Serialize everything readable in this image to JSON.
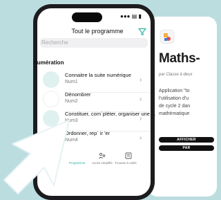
{
  "phone": {
    "status_icons": "●●● ▤ ▮",
    "nav_title": "Tout le programme",
    "search_placeholder": "Recherche",
    "section_label": "Numération",
    "items": [
      {
        "title": "Connaitre la suite numérique",
        "subtitle": "Num1"
      },
      {
        "title": "Dénombrer",
        "subtitle": "Num2"
      },
      {
        "title": "Constituer, com´pléter, organiser une ...",
        "subtitle": "Num3"
      },
      {
        "title": "Ordonner, rep´ ir     'er",
        "subtitle": "Num4"
      }
    ],
    "tabs": [
      "Programme",
      "Accès simplifié",
      "Trousse à outils"
    ]
  },
  "card": {
    "title": "Maths-",
    "byline": "par Classe à deux",
    "description": [
      "Application \"to",
      "l'utilisation d'u",
      "de cycle 2 dan",
      "mathématique"
    ],
    "buttons": [
      "AFFICHER",
      "PAR"
    ]
  },
  "colors": {
    "background": "#bcdde0",
    "accent": "#2bb3a4"
  },
  "icons": [
    "filter-icon",
    "chevron-right-icon",
    "app-logo-icon",
    "accessibility-icon",
    "toolbox-icon",
    "pointer-cursor-icon"
  ]
}
